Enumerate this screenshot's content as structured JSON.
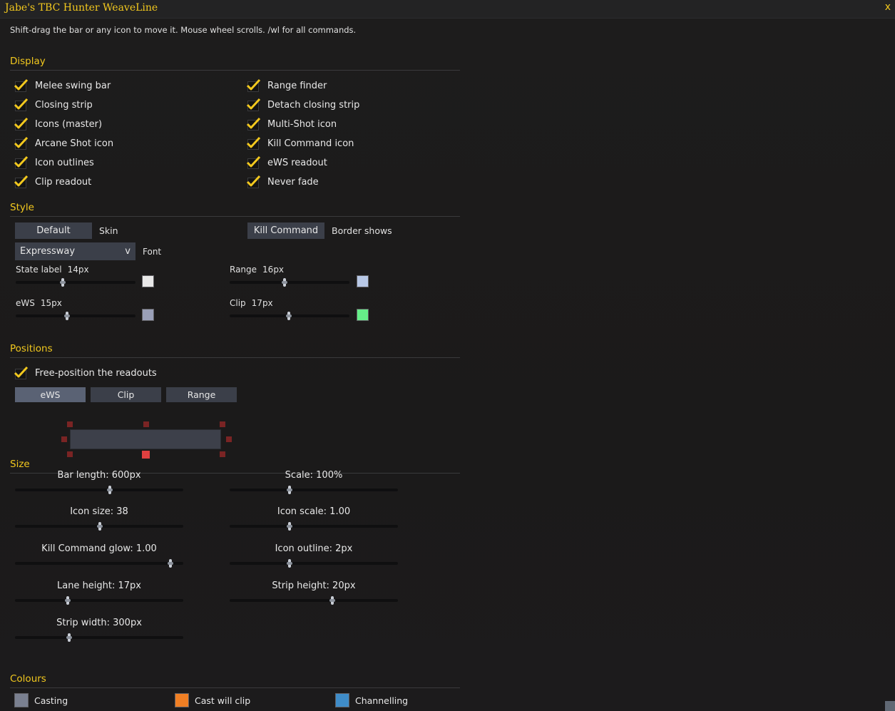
{
  "window": {
    "title": "Jabe's TBC Hunter WeaveLine",
    "close": "x"
  },
  "hint": "Shift-drag the bar or any icon to move it. Mouse wheel scrolls.  /wl for all commands.",
  "sections": {
    "display": "Display",
    "style": "Style",
    "positions": "Positions",
    "size": "Size",
    "colours": "Colours"
  },
  "display": {
    "left": [
      {
        "label": "Melee swing bar",
        "checked": true
      },
      {
        "label": "Closing strip",
        "checked": true
      },
      {
        "label": "Icons (master)",
        "checked": true
      },
      {
        "label": "Arcane Shot icon",
        "checked": true
      },
      {
        "label": "Icon outlines",
        "checked": true
      },
      {
        "label": "Clip readout",
        "checked": true
      }
    ],
    "right": [
      {
        "label": "Range finder",
        "checked": true
      },
      {
        "label": "Detach closing strip",
        "checked": true
      },
      {
        "label": "Multi-Shot icon",
        "checked": true
      },
      {
        "label": "Kill Command icon",
        "checked": true
      },
      {
        "label": "eWS readout",
        "checked": true
      },
      {
        "label": "Never fade",
        "checked": true
      }
    ]
  },
  "style": {
    "skin_button": "Default",
    "skin_label": "Skin",
    "border_button": "Kill Command",
    "border_label": "Border shows",
    "font_value": "Expressway",
    "font_arrow": "v",
    "font_label": "Font",
    "sliders": [
      {
        "name": "State label",
        "value": "14px",
        "fraction": 0.395,
        "color": "#e8e8e8"
      },
      {
        "name": "Range",
        "value": "16px",
        "fraction": 0.46,
        "color": "#b8c8e6"
      },
      {
        "name": "eWS",
        "value": "15px",
        "fraction": 0.43,
        "color": "#9aa0b8"
      },
      {
        "name": "Clip",
        "value": "17px",
        "fraction": 0.495,
        "color": "#66ee88"
      }
    ]
  },
  "positions": {
    "free_position": {
      "label": "Free-position the readouts",
      "checked": true
    },
    "tabs": [
      {
        "label": "eWS",
        "active": true
      },
      {
        "label": "Clip",
        "active": false
      },
      {
        "label": "Range",
        "active": false
      }
    ]
  },
  "size": {
    "sliders": [
      {
        "label": "Bar length: 600px",
        "fraction": 0.565
      },
      {
        "label": "Scale: 100%",
        "fraction": 0.355
      },
      {
        "label": "Icon size: 38",
        "fraction": 0.505
      },
      {
        "label": "Icon scale: 1.00",
        "fraction": 0.355
      },
      {
        "label": "Kill Command glow: 1.00",
        "fraction": 0.925
      },
      {
        "label": "Icon outline: 2px",
        "fraction": 0.355
      },
      {
        "label": "Lane height: 17px",
        "fraction": 0.315
      },
      {
        "label": "Strip height: 20px",
        "fraction": 0.61
      },
      {
        "label": "Strip width: 300px",
        "fraction": 0.32
      }
    ]
  },
  "colours": [
    {
      "label": "Casting",
      "color": "#7a8090"
    },
    {
      "label": "Cast will clip",
      "color": "#f07f24"
    },
    {
      "label": "Channelling",
      "color": "#3f8cc8"
    }
  ],
  "accent_color": "#f2c81e"
}
